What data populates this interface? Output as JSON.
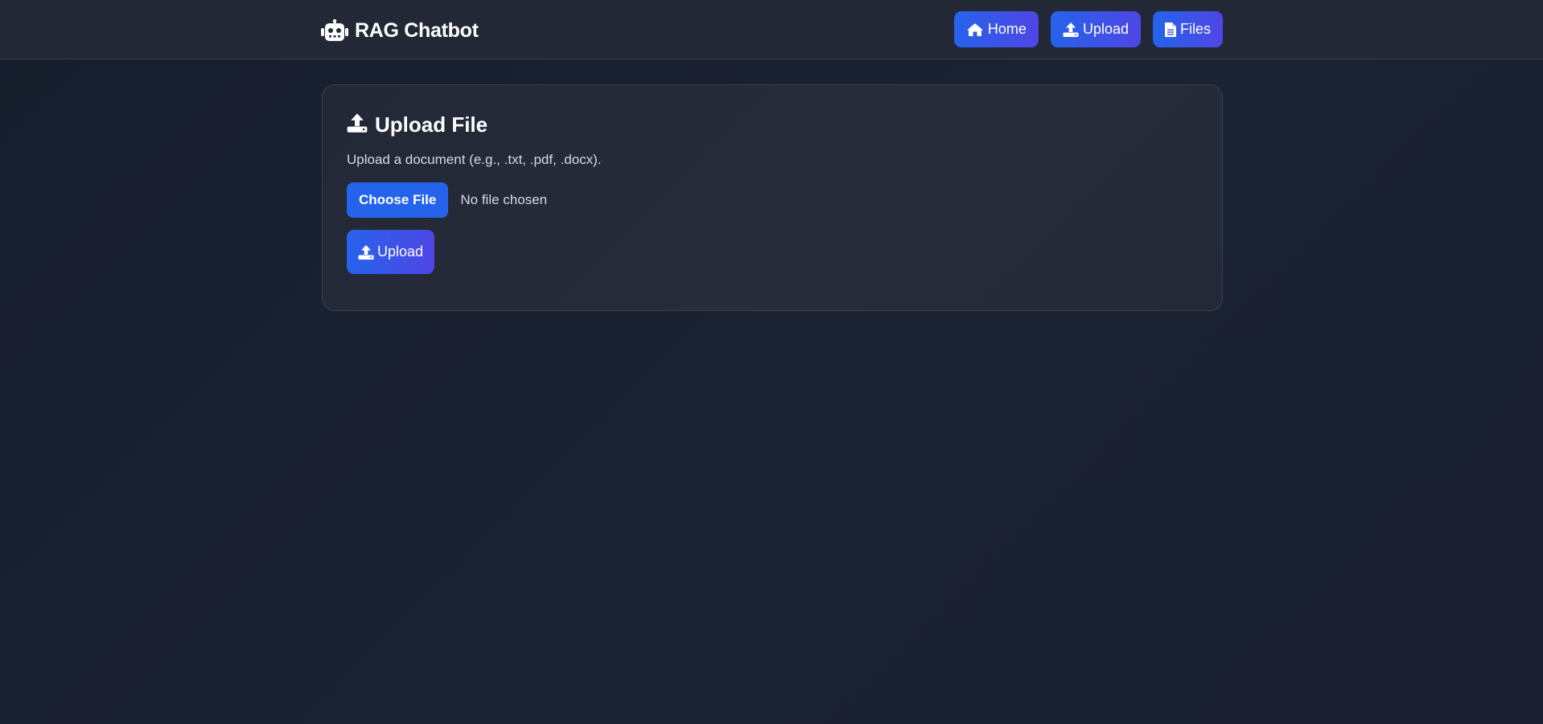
{
  "header": {
    "brand_icon": "robot-icon",
    "title": "RAG Chatbot",
    "nav": [
      {
        "label": "Home",
        "icon": "home-icon"
      },
      {
        "label": "Upload",
        "icon": "upload-icon"
      },
      {
        "label": "Files",
        "icon": "file-icon"
      }
    ]
  },
  "upload_card": {
    "icon": "upload-icon",
    "title": "Upload File",
    "description": "Upload a document (e.g., .txt, .pdf, .docx).",
    "choose_file_label": "Choose File",
    "file_status": "No file chosen",
    "submit_label": "Upload"
  },
  "colors": {
    "accent": "#2563eb",
    "accent_gradient_end": "#4f46e5",
    "background": "#1a2030",
    "card": "#242a38"
  }
}
